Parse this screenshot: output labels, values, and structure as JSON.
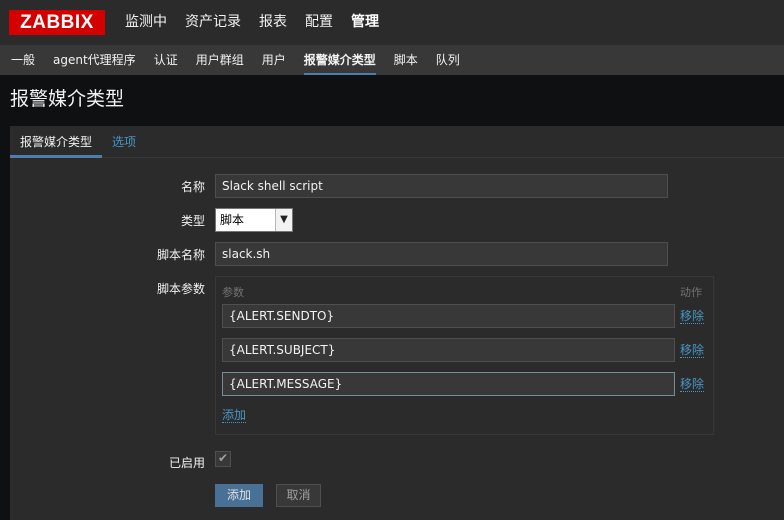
{
  "logo": "ZABBIX",
  "top_menu": [
    "监测中",
    "资产记录",
    "报表",
    "配置",
    "管理"
  ],
  "top_menu_active": "管理",
  "sub_menu": [
    "一般",
    "agent代理程序",
    "认证",
    "用户群组",
    "用户",
    "报警媒介类型",
    "脚本",
    "队列"
  ],
  "sub_menu_active": "报警媒介类型",
  "page_title": "报警媒介类型",
  "tabs": [
    "报警媒介类型",
    "选项"
  ],
  "form": {
    "name_label": "名称",
    "name_value": "Slack shell script",
    "type_label": "类型",
    "type_value": "脚本",
    "script_name_label": "脚本名称",
    "script_name_value": "slack.sh",
    "script_params_label": "脚本参数",
    "params_header": "参数",
    "action_header": "动作",
    "params": [
      "{ALERT.SENDTO}",
      "{ALERT.SUBJECT}",
      "{ALERT.MESSAGE}"
    ],
    "remove_label": "移除",
    "add_param_label": "添加",
    "enabled_label": "已启用",
    "enabled": true
  },
  "buttons": {
    "add": "添加",
    "cancel": "取消"
  },
  "colors": {
    "brand": "#d40000",
    "accent": "#4f7ea8",
    "link": "#4796c4"
  },
  "icons": {
    "dropdown": "chevron-down-icon",
    "checkbox": "check-icon"
  }
}
